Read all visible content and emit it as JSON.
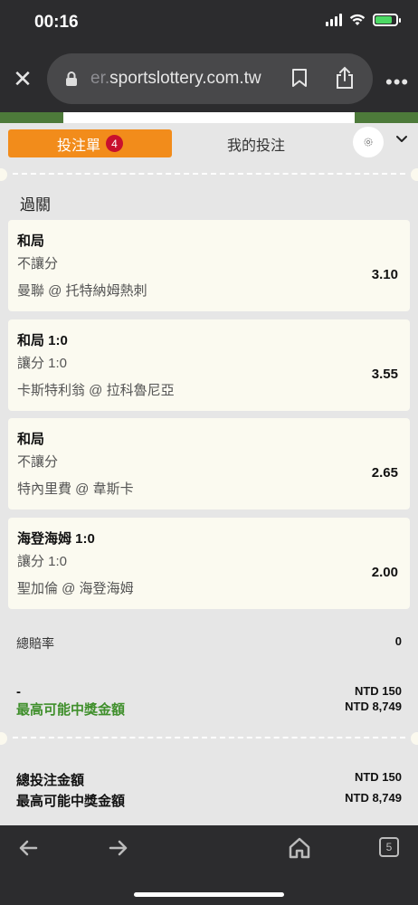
{
  "status_bar": {
    "time": "00:16"
  },
  "browser": {
    "url_faded": "er.",
    "url_main": "sportslottery.com.tw",
    "close_symbol": "✕",
    "more_symbol": "•••"
  },
  "tabs": {
    "active_label": "投注單",
    "badge_count": "4",
    "inactive_label": "我的投注"
  },
  "section_title": "過關",
  "bets": [
    {
      "title": "和局",
      "type": "不讓分",
      "match": "曼聯 @ 托特納姆熱刺",
      "odds": "3.10"
    },
    {
      "title": "和局 1:0",
      "type": "讓分 1:0",
      "match": "卡斯特利翁 @ 拉科魯尼亞",
      "odds": "3.55"
    },
    {
      "title": "和局",
      "type": "不讓分",
      "match": "特內里費 @ 韋斯卡",
      "odds": "2.65"
    },
    {
      "title": "海登海姆 1:0",
      "type": "讓分 1:0",
      "match": "聖加倫 @ 海登海姆",
      "odds": "2.00"
    }
  ],
  "summary": {
    "odds_label": "總賠率",
    "odds_value": "0",
    "stake_label": "-",
    "stake_value": "NTD 150",
    "max_win_label": "最高可能中獎金額",
    "max_win_value": "NTD 8,749"
  },
  "totals": {
    "total_stake_label": "總投注金額",
    "total_stake_value": "NTD 150",
    "max_win_label": "最高可能中獎金額",
    "max_win_value": "NTD 8,749"
  },
  "toolbar": {
    "tabs_count": "5"
  },
  "colors": {
    "accent": "#f28c1b",
    "badge": "#c8102e",
    "win_green": "#3f8f2b",
    "card_bg": "#fbfaf0"
  }
}
